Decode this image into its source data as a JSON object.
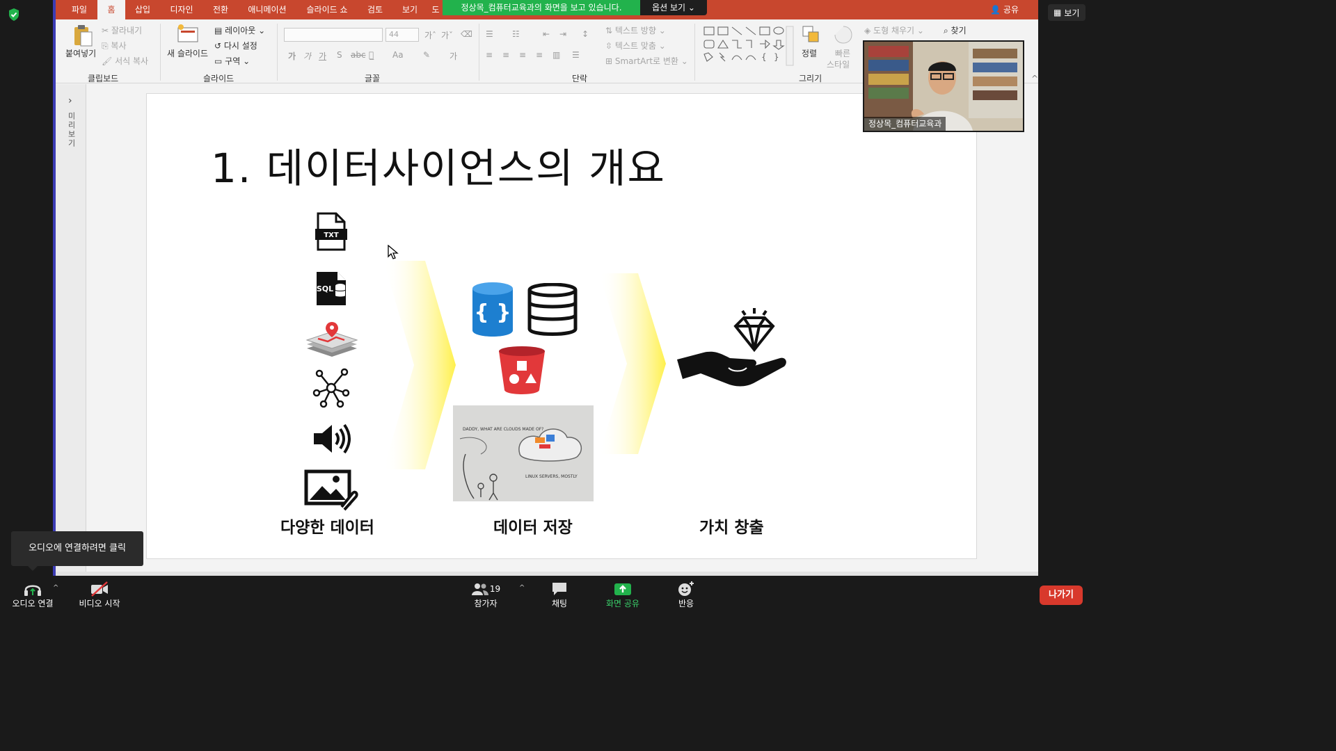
{
  "banner": {
    "text": "정상목_컴퓨터교육과의 화면을 보고 있습니다.",
    "options": "옵션 보기"
  },
  "topright": {
    "view_label": "보기"
  },
  "ppt": {
    "tabs": [
      "파일",
      "홈",
      "삽입",
      "디자인",
      "전환",
      "애니메이션",
      "슬라이드 쇼",
      "검토",
      "보기",
      "도"
    ],
    "active_tab": "홈",
    "share_label": "공유",
    "ribbon": {
      "clipboard": {
        "paste": "붙여넣기",
        "cut": "잘라내기",
        "copy": "복사",
        "format_painter": "서식 복사",
        "label": "클립보드"
      },
      "slides": {
        "new_slide": "새 슬라이드",
        "layout": "레이아웃",
        "reset": "다시 설정",
        "section": "구역",
        "label": "슬라이드"
      },
      "font": {
        "size": "44",
        "label": "글꼴"
      },
      "paragraph": {
        "text_direction": "텍스트 방향",
        "align_text": "텍스트 맞춤",
        "smartart": "SmartArt로 변환",
        "label": "단락"
      },
      "drawing": {
        "arrange": "정렬",
        "quick_styles_1": "빠른",
        "quick_styles_2": "스타일",
        "shape_fill": "도형 채우기",
        "find": "찾기",
        "label": "그리기"
      }
    },
    "thumb_panel_label": "미리보기"
  },
  "slide": {
    "title": "1. 데이터사이언스의 개요",
    "captions": [
      "다양한 데이터",
      "데이터 저장",
      "가치 창출"
    ],
    "icons": {
      "txt_label": "TXT",
      "sql_label": "SQL",
      "json_label": "{ }",
      "sketch_text_1": "DADDY, WHAT ARE CLOUDS MADE OF?",
      "sketch_text_2": "LINUX SERVERS, MOSTLY"
    }
  },
  "video": {
    "name": "정상목_컴퓨터교육과"
  },
  "tooltip": {
    "text": "오디오에 연결하려면 클릭"
  },
  "toolbar": {
    "audio": "오디오 연결",
    "video": "비디오 시작",
    "participants": "참가자",
    "participants_count": "19",
    "chat": "채팅",
    "share": "화면 공유",
    "reactions": "반응",
    "leave": "나가기"
  },
  "colors": {
    "ppt_accent": "#c8472e",
    "zoom_green": "#22b24c",
    "leave_red": "#d8392c",
    "db_blue": "#1d7fd0",
    "bucket_red": "#e2383a"
  }
}
